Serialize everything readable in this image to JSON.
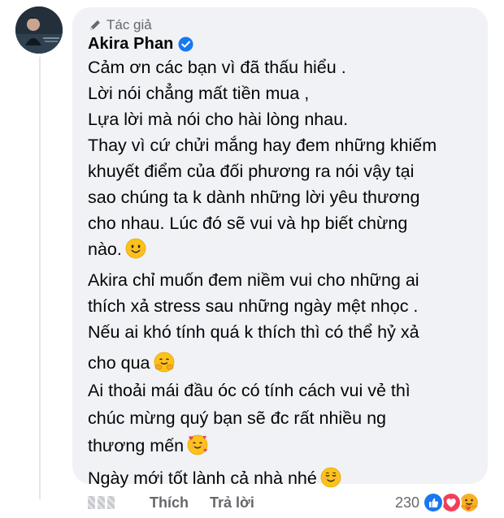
{
  "comment": {
    "badge_label": "Tác giả",
    "author": "Akira Phan",
    "verified": true,
    "lines": [
      "Cảm ơn các bạn vì đã thấu hiểu .",
      "Lời nói chẳng mất tiền mua ,",
      "Lựa lời mà nói cho hài lòng nhau.",
      "Thay vì cứ chửi mắng hay đem những khiếm",
      "khuyết điểm của đối phương ra nói vậy tại",
      "sao chúng ta k dành những lời yêu thương",
      "cho nhau. Lúc đó sẽ vui và hp biết chừng",
      "nào.",
      "Akira chỉ muốn đem niềm vui cho những ai",
      "thích xả stress sau những ngày mệt nhọc .",
      "Nếu ai khó tính quá k thích thì có thể hỷ xả",
      "cho qua",
      "Ai thoải mái đầu óc có tính cách vui vẻ thì",
      "chúc mừng quý bạn sẽ đc rất nhiều ng",
      "thương mến",
      "Ngày mới tốt lành cả nhà nhé"
    ],
    "line_emojis": {
      "7": "smiling-face-emoji",
      "11": "hugging-face-emoji",
      "14": "smiling-face-with-hearts-emoji",
      "15": "relieved-smiling-face-emoji"
    }
  },
  "actions": {
    "like_label": "Thích",
    "reply_label": "Trả lời"
  },
  "reactions": {
    "count": "230",
    "icons": [
      "like-reaction-icon",
      "love-reaction-icon",
      "care-reaction-icon"
    ]
  },
  "colors": {
    "bubble_bg": "#f0f2f5",
    "text": "#050505",
    "secondary_text": "#65676b",
    "verified_blue": "#1877f2",
    "love_red": "#f33e58",
    "like_blue": "#1877f2"
  }
}
